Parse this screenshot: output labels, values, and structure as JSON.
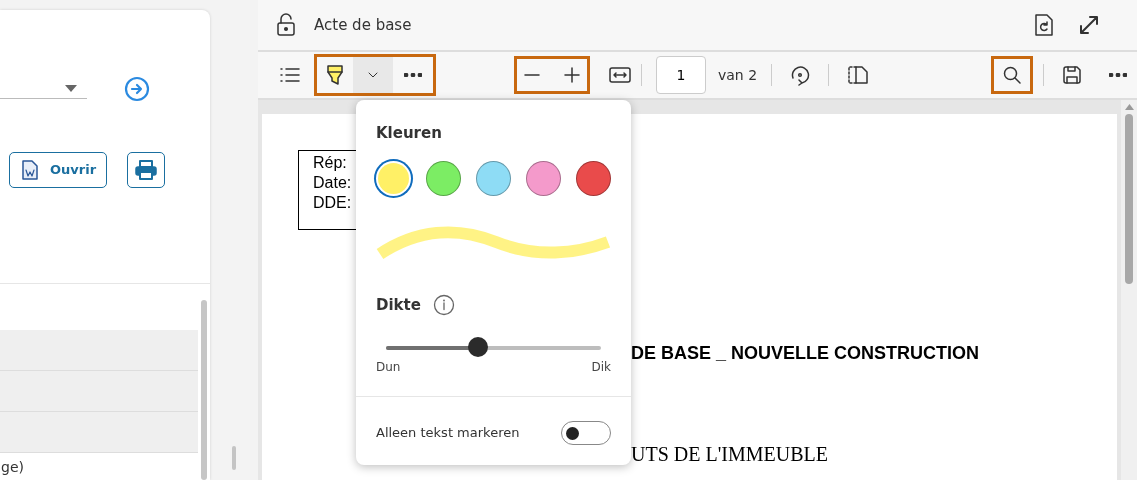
{
  "left_panel": {
    "open_button": {
      "label": "Ouvrir"
    },
    "list_item_text": "ge)"
  },
  "viewer": {
    "title": "Acte de base",
    "page_input": "1",
    "page_total": "van 2"
  },
  "document": {
    "header_lines": [
      "Rép:",
      "Date:",
      "DDE:"
    ],
    "title": "DE BASE _ NOUVELLE CONSTRUCTION",
    "heading": "UTS DE L'IMMEUBLE"
  },
  "highlight_popup": {
    "colors_label": "Kleuren",
    "colors": [
      {
        "color": "#fff066",
        "selected": true
      },
      {
        "color": "#7ced64",
        "selected": false
      },
      {
        "color": "#8edcf5",
        "selected": false
      },
      {
        "color": "#f49acb",
        "selected": false
      },
      {
        "color": "#e94b4b",
        "selected": false
      }
    ],
    "thickness": {
      "label": "Dikte",
      "level": 0.43,
      "min_label": "Dun",
      "max_label": "Dik"
    },
    "toggle": {
      "label": "Alleen tekst markeren",
      "on": false
    }
  }
}
